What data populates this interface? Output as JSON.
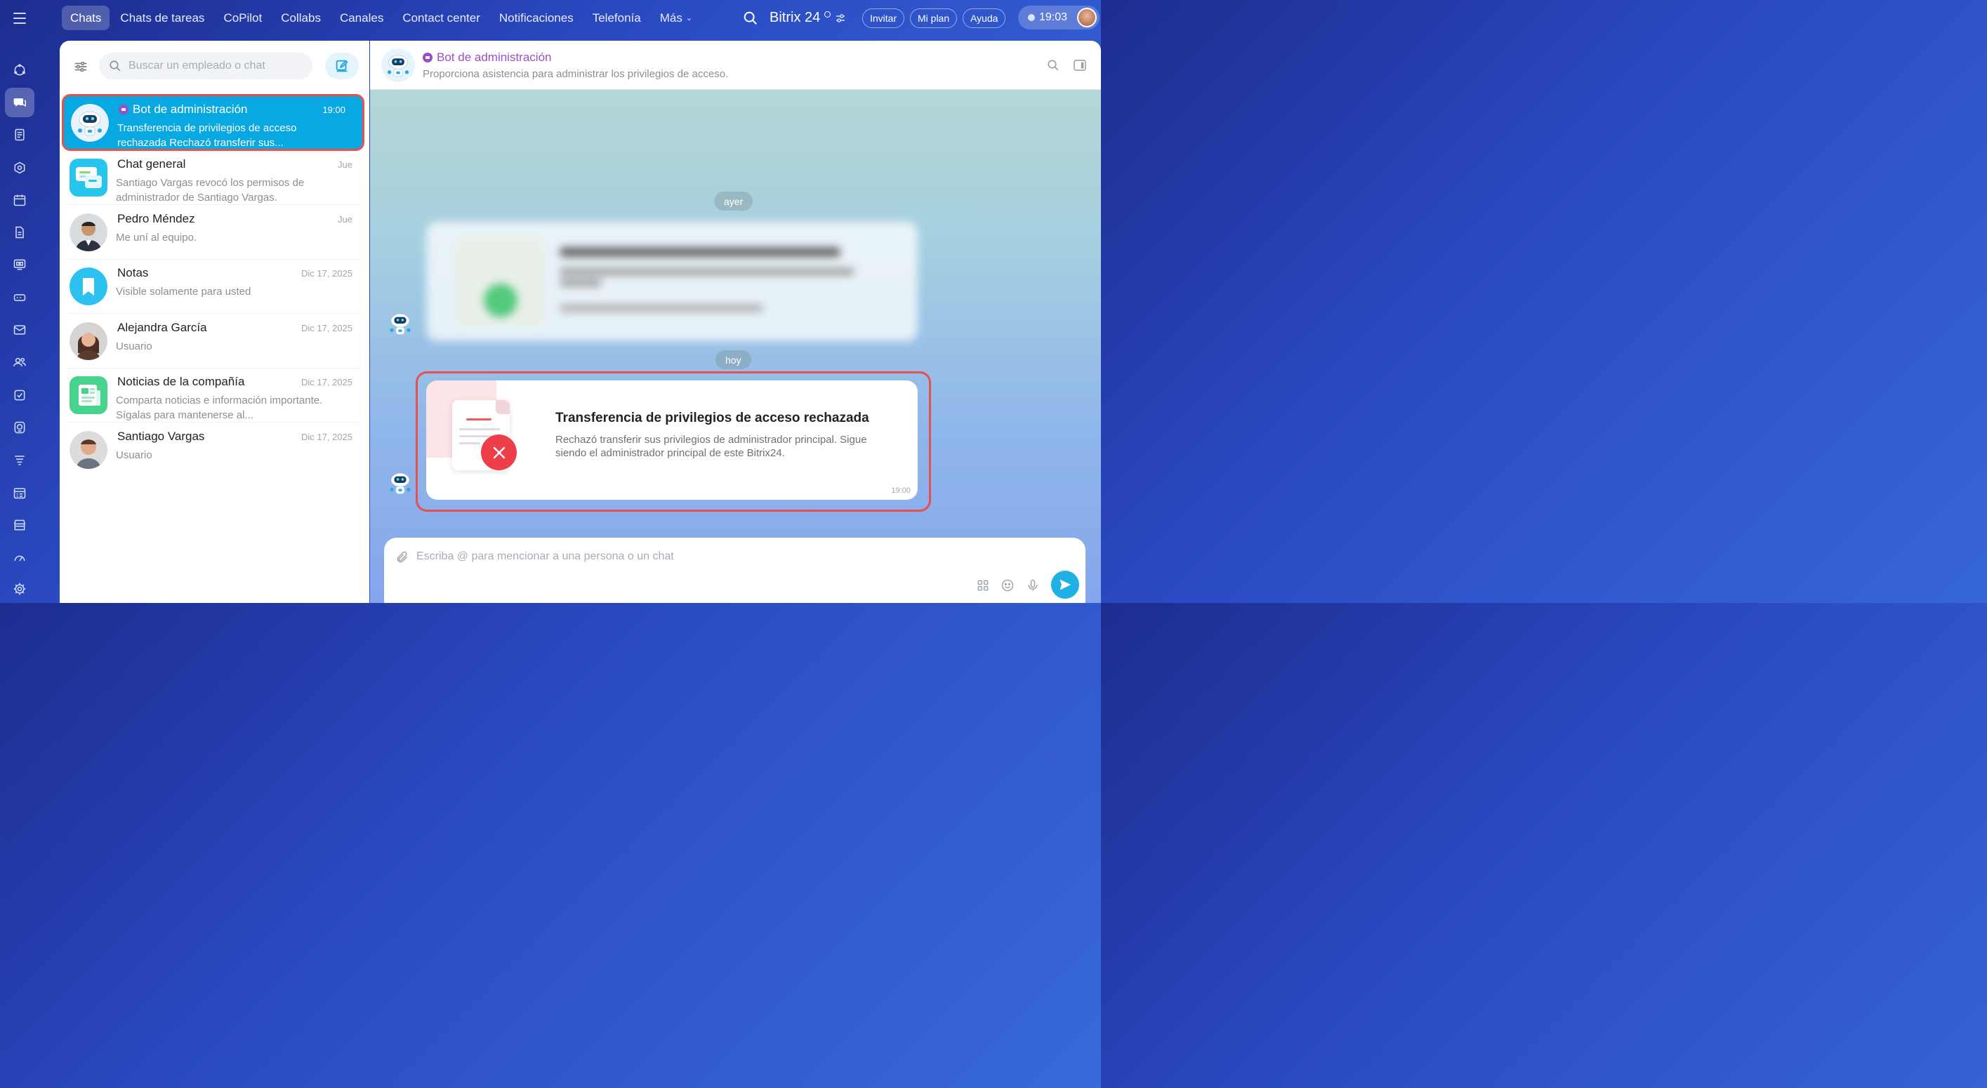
{
  "topnav": {
    "items": [
      "Chats",
      "Chats de tareas",
      "CoPilot",
      "Collabs",
      "Canales",
      "Contact center",
      "Notificaciones",
      "Telefonía"
    ],
    "more_label": "Más",
    "brand": "Bitrix 24",
    "invite_label": "Invitar",
    "plan_label": "Mi plan",
    "help_label": "Ayuda",
    "clock": "19:03"
  },
  "chatlist": {
    "search_placeholder": "Buscar un empleado o chat",
    "items": [
      {
        "name": "Bot de administración",
        "time": "19:00",
        "preview": "Transferencia de privilegios de acceso rechazada Rechazó transferir sus..."
      },
      {
        "name": "Chat general",
        "time": "Jue",
        "preview": "Santiago Vargas revocó los permisos de administrador de Santiago Vargas."
      },
      {
        "name": "Pedro Méndez",
        "time": "Jue",
        "preview": "Me uní al equipo."
      },
      {
        "name": "Notas",
        "time": "Dic 17, 2025",
        "preview": "Visible solamente para usted"
      },
      {
        "name": "Alejandra García",
        "time": "Dic 17, 2025",
        "preview": "Usuario"
      },
      {
        "name": "Noticias de la compañía",
        "time": "Dic 17, 2025",
        "preview": "Comparta noticias e información importante. Sígalas para mantenerse al..."
      },
      {
        "name": "Santiago Vargas",
        "time": "Dic 17, 2025",
        "preview": "Usuario"
      }
    ]
  },
  "chat": {
    "name": "Bot de administración",
    "description": "Proporciona asistencia para administrar los privilegios de acceso.",
    "date_yesterday": "ayer",
    "date_today": "hoy",
    "message": {
      "title": "Transferencia de privilegios de acceso rechazada",
      "body": "Rechazó transferir sus privilegios de administrador principal. Sigue siendo el administrador principal de este Bitrix24.",
      "time": "19:00"
    },
    "composer_placeholder": "Escriba @ para mencionar a una persona o un chat"
  },
  "colors": {
    "accent": "#08a9e3",
    "bot_name": "#9b4fc6",
    "highlight": "#e5514f",
    "error": "#ee3e4a"
  }
}
